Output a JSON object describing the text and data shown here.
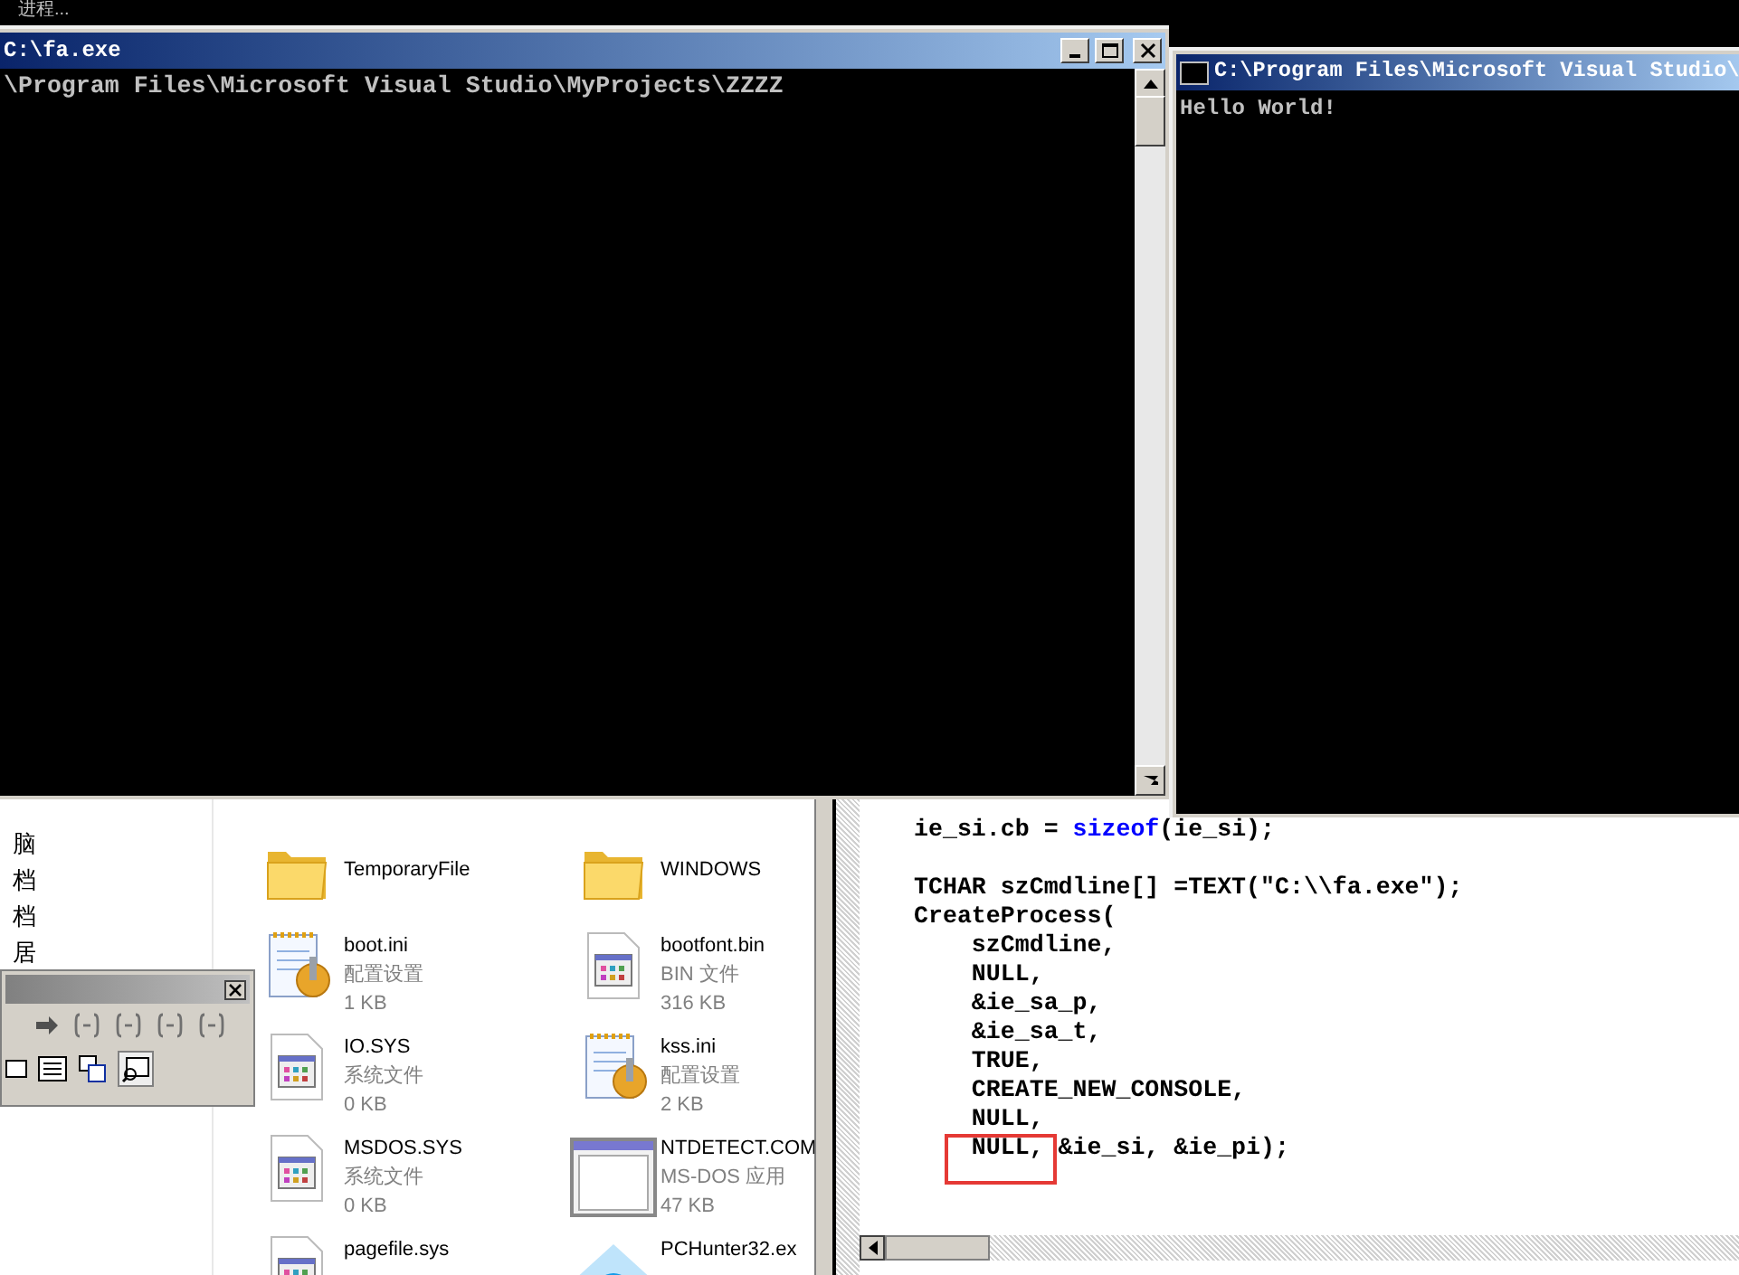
{
  "desktop_text": "进程...",
  "console_main": {
    "title": "C:\\fa.exe",
    "lines": [
      "\\Program Files\\Microsoft Visual Studio\\MyProjects\\ZZZZ"
    ]
  },
  "console_output": {
    "title": "C:\\Program Files\\Microsoft Visual Studio\\",
    "lines": [
      "Hello World!"
    ]
  },
  "explorer": {
    "tree_items": [
      "脑",
      "档",
      "档",
      "居"
    ],
    "files": [
      {
        "name": "TemporaryFile",
        "kind": "folder"
      },
      {
        "name": "WINDOWS",
        "kind": "folder"
      },
      {
        "name": "boot.ini",
        "type": "配置设置",
        "size": "1 KB",
        "kind": "config"
      },
      {
        "name": "bootfont.bin",
        "type": "BIN 文件",
        "size": "316 KB",
        "kind": "system"
      },
      {
        "name": "IO.SYS",
        "type": "系统文件",
        "size": "0 KB",
        "kind": "system"
      },
      {
        "name": "kss.ini",
        "type": "配置设置",
        "size": "2 KB",
        "kind": "config"
      },
      {
        "name": "MSDOS.SYS",
        "type": "系统文件",
        "size": "0 KB",
        "kind": "system"
      },
      {
        "name": "NTDETECT.COM",
        "type": "MS-DOS 应用",
        "size": "47 KB",
        "kind": "app"
      },
      {
        "name": "pagefile.sys",
        "kind": "system"
      },
      {
        "name": "PCHunter32.ex",
        "kind": "hunter"
      }
    ]
  },
  "code_editor": {
    "lines": [
      {
        "parts": [
          {
            "text": "ie_si.cb = "
          },
          {
            "text": "sizeof",
            "kind": "keyword"
          },
          {
            "text": "(ie_si);"
          }
        ]
      },
      {
        "kind": "blank"
      },
      {
        "parts": [
          {
            "text": "TCHAR szCmdline[] =TEXT(\"C:\\\\fa.exe\");"
          }
        ]
      },
      {
        "parts": [
          {
            "text": "CreateProcess("
          }
        ]
      },
      {
        "parts": [
          {
            "text": "    szCmdline,"
          }
        ]
      },
      {
        "parts": [
          {
            "text": "    NULL,"
          }
        ]
      },
      {
        "parts": [
          {
            "text": "    &ie_sa_p,"
          }
        ]
      },
      {
        "parts": [
          {
            "text": "    &ie_sa_t,"
          }
        ]
      },
      {
        "parts": [
          {
            "text": "    TRUE,"
          }
        ]
      },
      {
        "parts": [
          {
            "text": "    CREATE_NEW_CONSOLE,"
          }
        ]
      },
      {
        "parts": [
          {
            "text": "    NULL,"
          }
        ]
      },
      {
        "parts": [
          {
            "text": "    NULL, &ie_si, &ie_pi);"
          }
        ],
        "highlighted": true
      }
    ]
  }
}
